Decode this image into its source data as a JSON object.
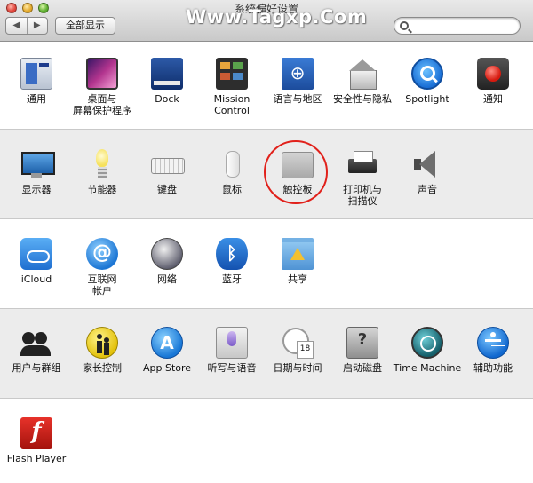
{
  "window": {
    "title": "系统偏好设置",
    "watermark": "Www.Tagxp.Com",
    "back_label": "◀",
    "forward_label": "▶",
    "show_all_label": "全部显示",
    "search_placeholder": "",
    "highlight_color": "#e1211b"
  },
  "sections": [
    {
      "items": [
        {
          "name": "general",
          "label": "通用",
          "icon": "general-icon"
        },
        {
          "name": "desktop",
          "label": "桌面与\n屏幕保护程序",
          "icon": "desktop-icon"
        },
        {
          "name": "dock",
          "label": "Dock",
          "icon": "dock-icon"
        },
        {
          "name": "mission-control",
          "label": "Mission\nControl",
          "icon": "mission-control-icon"
        },
        {
          "name": "language",
          "label": "语言与地区",
          "icon": "language-icon"
        },
        {
          "name": "security",
          "label": "安全性与隐私",
          "icon": "security-icon"
        },
        {
          "name": "spotlight",
          "label": "Spotlight",
          "icon": "spotlight-icon"
        },
        {
          "name": "notifications",
          "label": "通知",
          "icon": "notifications-icon"
        }
      ]
    },
    {
      "items": [
        {
          "name": "displays",
          "label": "显示器",
          "icon": "display-icon"
        },
        {
          "name": "energy",
          "label": "节能器",
          "icon": "bulb-icon"
        },
        {
          "name": "keyboard",
          "label": "键盘",
          "icon": "keyboard-icon"
        },
        {
          "name": "mouse",
          "label": "鼠标",
          "icon": "mouse-icon"
        },
        {
          "name": "trackpad",
          "label": "触控板",
          "icon": "trackpad-icon"
        },
        {
          "name": "printers",
          "label": "打印机与\n扫描仪",
          "icon": "printer-icon"
        },
        {
          "name": "sound",
          "label": "声音",
          "icon": "speaker-icon"
        }
      ]
    },
    {
      "items": [
        {
          "name": "icloud",
          "label": "iCloud",
          "icon": "cloud-icon"
        },
        {
          "name": "internet-accounts",
          "label": "互联网\n帐户",
          "icon": "at-icon"
        },
        {
          "name": "network",
          "label": "网络",
          "icon": "globe-icon"
        },
        {
          "name": "bluetooth",
          "label": "蓝牙",
          "icon": "bluetooth-icon"
        },
        {
          "name": "sharing",
          "label": "共享",
          "icon": "sharing-folder-icon"
        }
      ]
    },
    {
      "items": [
        {
          "name": "users",
          "label": "用户与群组",
          "icon": "users-icon"
        },
        {
          "name": "parental",
          "label": "家长控制",
          "icon": "parental-icon"
        },
        {
          "name": "app-store",
          "label": "App Store",
          "icon": "app-store-icon"
        },
        {
          "name": "dictation",
          "label": "听写与语音",
          "icon": "microphone-icon"
        },
        {
          "name": "date-time",
          "label": "日期与时间",
          "icon": "clock-icon"
        },
        {
          "name": "startup-disk",
          "label": "启动磁盘",
          "icon": "disk-icon"
        },
        {
          "name": "time-machine",
          "label": "Time Machine",
          "icon": "time-machine-icon"
        },
        {
          "name": "accessibility",
          "label": "辅助功能",
          "icon": "accessibility-icon"
        }
      ]
    },
    {
      "items": [
        {
          "name": "flash-player",
          "label": "Flash Player",
          "icon": "flash-icon"
        }
      ]
    }
  ]
}
